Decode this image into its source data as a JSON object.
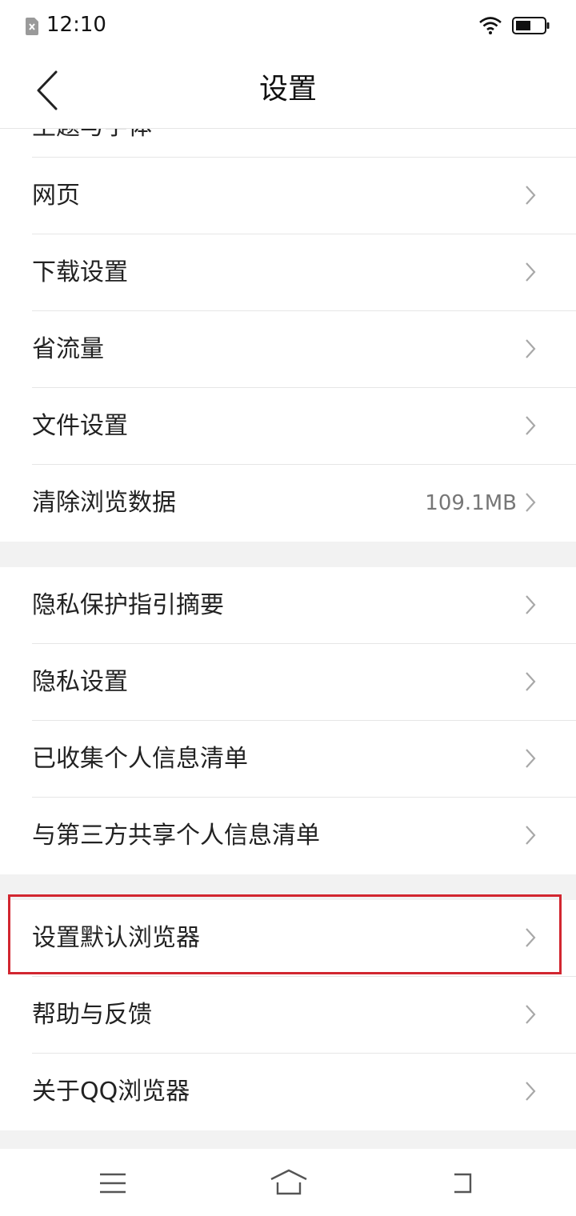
{
  "status_bar": {
    "time": "12:10",
    "icons": [
      "sim-icon",
      "wifi-icon",
      "battery-icon"
    ]
  },
  "header": {
    "title": "设置",
    "back_icon": "chevron-left-icon"
  },
  "partial_item": {
    "label": "主题与字体"
  },
  "groups": [
    {
      "items": [
        {
          "label": "网页"
        },
        {
          "label": "下载设置"
        },
        {
          "label": "省流量"
        },
        {
          "label": "文件设置"
        },
        {
          "label": "清除浏览数据",
          "value": "109.1MB"
        }
      ]
    },
    {
      "items": [
        {
          "label": "隐私保护指引摘要"
        },
        {
          "label": "隐私设置"
        },
        {
          "label": "已收集个人信息清单"
        },
        {
          "label": "与第三方共享个人信息清单"
        }
      ]
    },
    {
      "items": [
        {
          "label": "设置默认浏览器",
          "highlighted": true
        },
        {
          "label": "帮助与反馈"
        },
        {
          "label": "关于QQ浏览器"
        }
      ]
    }
  ],
  "nav_bar": {
    "icons": [
      "menu-icon",
      "home-icon",
      "back-icon"
    ]
  },
  "colors": {
    "highlight": "#d22630",
    "chevron": "#a8a8a8",
    "divider": "#e6e6e6",
    "background": "#f2f2f2"
  }
}
